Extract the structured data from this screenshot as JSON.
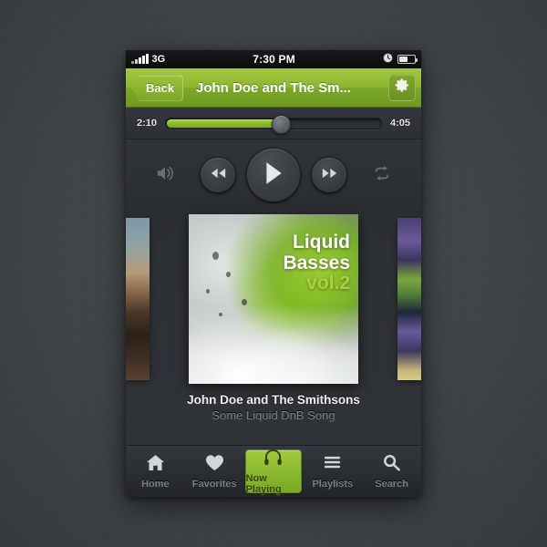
{
  "status_bar": {
    "carrier": "3G",
    "time": "7:30 PM",
    "signal_icon": "signal-bars-icon",
    "clock_icon": "clock-icon",
    "battery_icon": "battery-icon"
  },
  "nav_bar": {
    "back_label": "Back",
    "title": "John Doe and The Sm...",
    "settings_icon": "gear-icon",
    "accent_color": "#8cb631"
  },
  "progress": {
    "elapsed": "2:10",
    "total": "4:05",
    "percent": 53,
    "fill_color": "#8cbc2a"
  },
  "controls": {
    "volume_icon": "volume-icon",
    "previous_icon": "rewind-icon",
    "play_icon": "play-icon",
    "next_icon": "fast-forward-icon",
    "repeat_icon": "repeat-icon"
  },
  "artwork": {
    "line1": "Liquid",
    "line2": "Basses",
    "volume": "vol.2",
    "volume_color": "#a8d23f",
    "prev_thumb": "previous-album-thumbnail",
    "next_thumb": "next-album-thumbnail"
  },
  "track": {
    "artist": "John Doe and The Smithsons",
    "title": "Some Liquid DnB Song"
  },
  "tab_bar": {
    "items": [
      {
        "label": "Home",
        "icon": "home-icon",
        "active": false
      },
      {
        "label": "Favorites",
        "icon": "heart-icon",
        "active": false
      },
      {
        "label": "Now Playing",
        "icon": "headphones-icon",
        "active": true
      },
      {
        "label": "Playlists",
        "icon": "list-icon",
        "active": false
      },
      {
        "label": "Search",
        "icon": "search-icon",
        "active": false
      }
    ]
  }
}
